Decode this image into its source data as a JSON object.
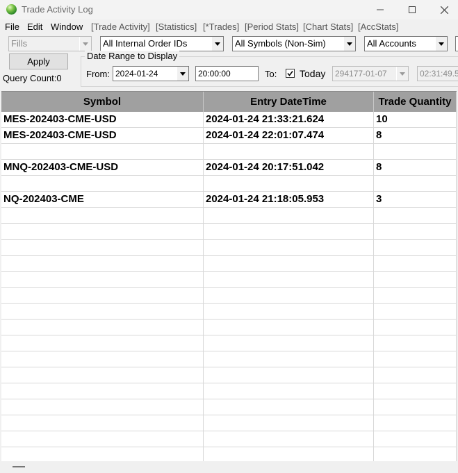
{
  "window": {
    "title": "Trade Activity Log"
  },
  "menu": [
    {
      "label": "File"
    },
    {
      "label": "Edit"
    },
    {
      "label": "Window"
    },
    {
      "label": "[Trade Activity]"
    },
    {
      "label": "[Statistics]"
    },
    {
      "label": "[*Trades]"
    },
    {
      "label": "[Period Stats]"
    },
    {
      "label": "[Chart Stats]"
    },
    {
      "label": "[AccStats]"
    }
  ],
  "filters": {
    "fills": "Fills",
    "order_ids": "All Internal Order IDs",
    "symbols": "All Symbols (Non-Sim)",
    "accounts": "All Accounts"
  },
  "apply_label": "Apply",
  "query_count": "Query Count:0",
  "date_range": {
    "legend": "Date Range to Display",
    "from_label": "From:",
    "from_date": "2024-01-24",
    "from_time": "20:00:00",
    "to_label": "To:",
    "today_checked": true,
    "today_label": "Today",
    "to_date": "294177-01-07",
    "to_time": "02:31:49.5"
  },
  "table": {
    "columns": [
      "Symbol",
      "Entry DateTime",
      "Trade Quantity"
    ],
    "rows": [
      [
        "MES-202403-CME-USD",
        "2024-01-24  21:33:21.624",
        "10"
      ],
      [
        "MES-202403-CME-USD",
        "2024-01-24  22:01:07.474",
        "8"
      ],
      [
        "",
        "",
        ""
      ],
      [
        "MNQ-202403-CME-USD",
        "2024-01-24  20:17:51.042",
        "8"
      ],
      [
        "",
        "",
        ""
      ],
      [
        "NQ-202403-CME",
        "2024-01-24  21:18:05.953",
        "3"
      ],
      [
        "",
        "",
        ""
      ],
      [
        "",
        "",
        ""
      ],
      [
        "",
        "",
        ""
      ],
      [
        "",
        "",
        ""
      ],
      [
        "",
        "",
        ""
      ],
      [
        "",
        "",
        ""
      ],
      [
        "",
        "",
        ""
      ],
      [
        "",
        "",
        ""
      ],
      [
        "",
        "",
        ""
      ],
      [
        "",
        "",
        ""
      ],
      [
        "",
        "",
        ""
      ],
      [
        "",
        "",
        ""
      ],
      [
        "",
        "",
        ""
      ],
      [
        "",
        "",
        ""
      ],
      [
        "",
        "",
        ""
      ],
      [
        "",
        "",
        ""
      ]
    ]
  },
  "icons": {
    "app": "app-globe-icon",
    "minimize": "minimize-icon",
    "maximize": "maximize-icon",
    "close": "close-icon"
  }
}
